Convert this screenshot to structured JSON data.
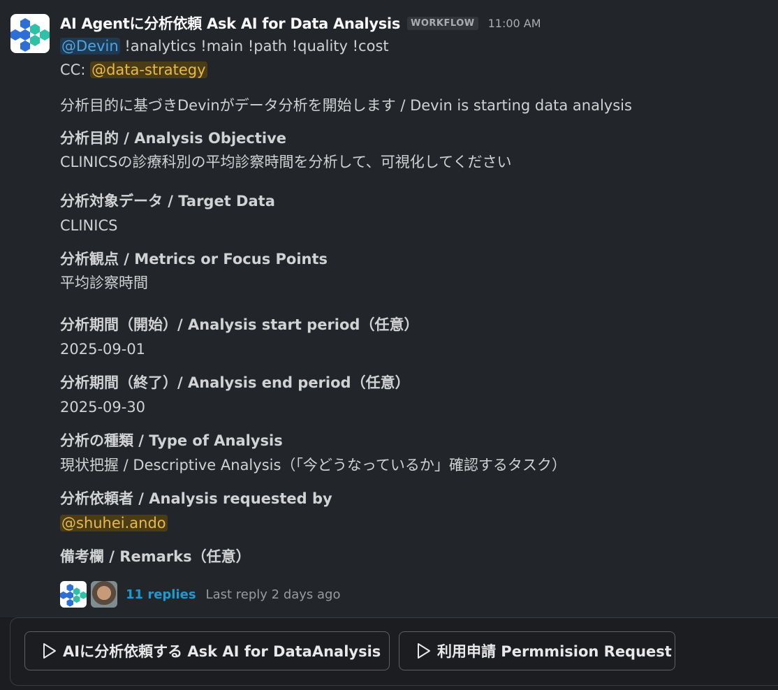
{
  "message": {
    "app_name": "AI Agentに分析依頼 Ask AI for Data Analysis",
    "badge": "WORKFLOW",
    "timestamp": "11:00 AM",
    "command_mention": "@Devin",
    "command_text": " !analytics !main !path !quality !cost",
    "cc_label": "CC: ",
    "cc_mention": "@data-strategy",
    "intro": "分析目的に基づきDevinがデータ分析を開始します / Devin is starting data analysis",
    "fields": [
      {
        "label": "分析目的 / Analysis Objective",
        "value": "CLINICSの診療科別の平均診察時間を分析して、可視化してください"
      },
      {
        "label": "分析対象データ / Target Data",
        "value": "CLINICS"
      },
      {
        "label": "分析観点 / Metrics or Focus Points",
        "value": "平均診察時間"
      },
      {
        "label": "分析期間（開始）/ Analysis start period（任意）",
        "value": "2025-09-01"
      },
      {
        "label": "分析期間（終了）/ Analysis end period（任意）",
        "value": "2025-09-30"
      },
      {
        "label": "分析の種類 / Type of Analysis",
        "value": "現状把握 / Descriptive Analysis（「今どうなっているか」確認するタスク）"
      },
      {
        "label": "分析依頼者 / Analysis requested by",
        "value": "@shuhei.ando"
      },
      {
        "label": "備考欄 / Remarks（任意）",
        "value": ""
      }
    ]
  },
  "thread": {
    "replies_label": "11 replies",
    "last_reply": "Last reply 2 days ago"
  },
  "actions": {
    "ask_ai_label": "AIに分析依頼する Ask AI for DataAnalysis",
    "permission_label": "利用申請 Permmision Request"
  },
  "colors": {
    "background": "#222529",
    "mention_blue": "#4ea4e1",
    "mention_yellow": "#e8b94b",
    "link": "#1d9bd1",
    "logo_blue": "#2d6fd6",
    "logo_teal": "#2fc1a5"
  },
  "icons": {
    "app_avatar": "hexagon-cluster-logo",
    "button_icon": "play-outline-icon"
  }
}
